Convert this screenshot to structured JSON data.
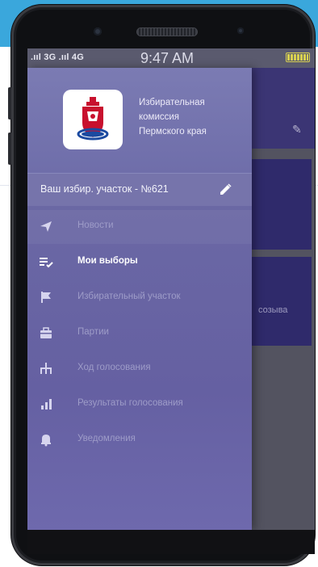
{
  "status_bar": {
    "network": ".ııl 3G .ııl 4G",
    "time": "9:47 AM"
  },
  "drawer": {
    "org_name_lines": [
      "Избирательная",
      "комиссия",
      "Пермского края"
    ],
    "precinct_label": "Ваш избир. участок - №621",
    "menu_items": [
      {
        "label": "Новости",
        "icon": "send-icon",
        "state": "normal"
      },
      {
        "label": "Мои выборы",
        "icon": "checklist-icon",
        "state": "selected"
      },
      {
        "label": "Избирательный участок",
        "icon": "flag-icon",
        "state": "normal"
      },
      {
        "label": "Партии",
        "icon": "briefcase-icon",
        "state": "normal"
      },
      {
        "label": "Ход голосования",
        "icon": "tree-icon",
        "state": "normal"
      },
      {
        "label": "Результаты голосования",
        "icon": "bar-chart-icon",
        "state": "normal"
      },
      {
        "label": "Уведомления",
        "icon": "bell-icon",
        "state": "normal"
      }
    ]
  },
  "background_app": {
    "partial_text": "созыва"
  },
  "colors": {
    "drawer": "#6a67a4",
    "app_header": "#3b3574",
    "card": "#2f2a6b",
    "page_strip": "#3aa7dc"
  }
}
